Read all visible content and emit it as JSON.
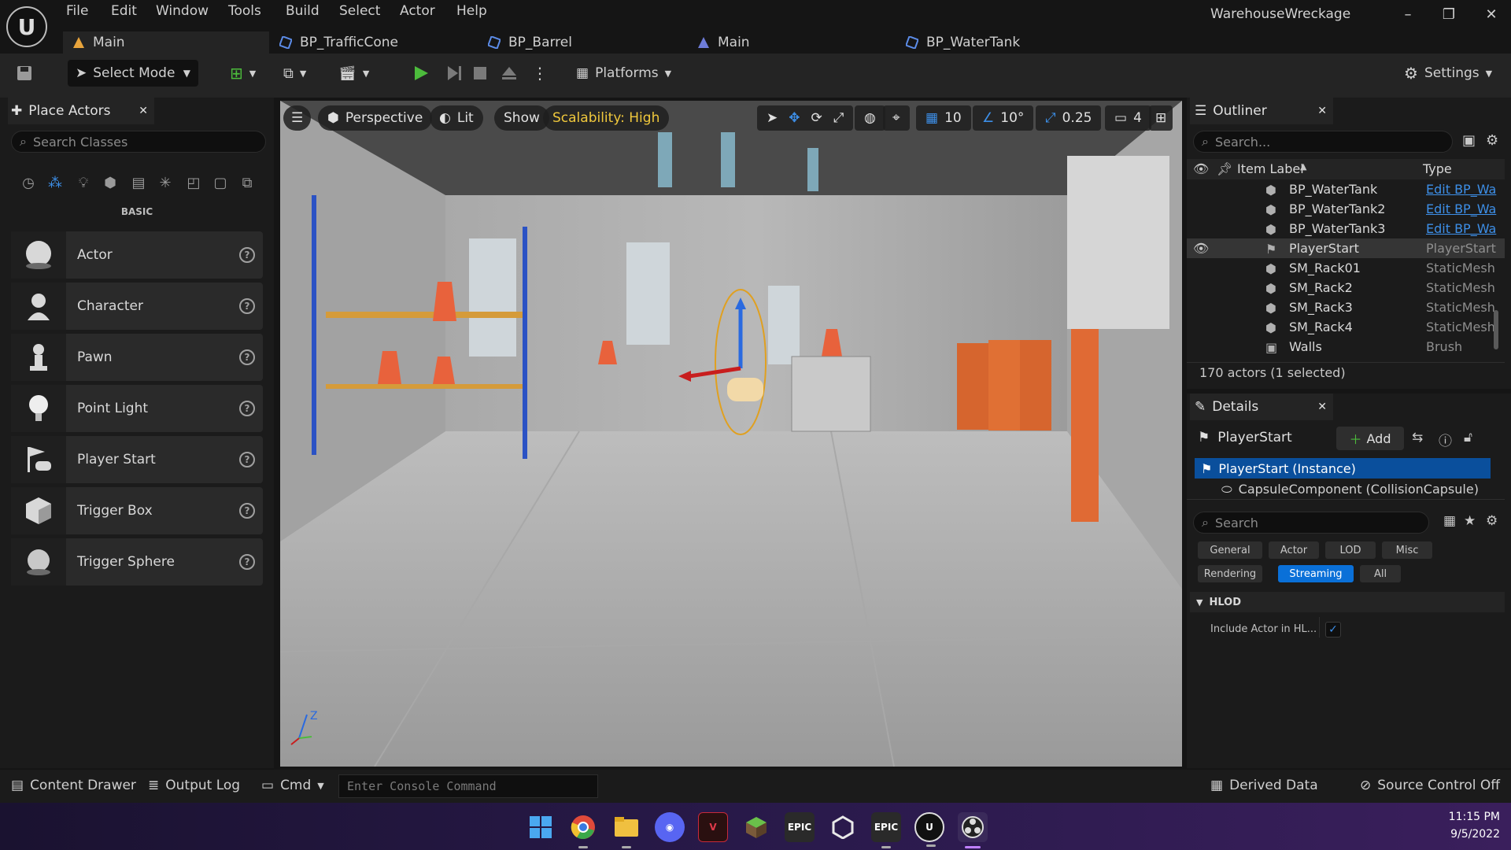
{
  "menu": [
    "File",
    "Edit",
    "Window",
    "Tools",
    "Build",
    "Select",
    "Actor",
    "Help"
  ],
  "project_name": "WarehouseWreckage",
  "tabs": [
    {
      "label": "Main",
      "icon": "level-icon"
    },
    {
      "label": "BP_TrafficCone",
      "icon": "blueprint-icon"
    },
    {
      "label": "BP_Barrel",
      "icon": "blueprint-icon"
    },
    {
      "label": "Main",
      "icon": "level-icon"
    },
    {
      "label": "BP_WaterTank",
      "icon": "blueprint-icon"
    }
  ],
  "toolbar": {
    "select_mode": "Select Mode",
    "platforms": "Platforms",
    "settings": "Settings"
  },
  "place_actors": {
    "title": "Place Actors",
    "search_placeholder": "Search Classes",
    "category": "BASIC",
    "items": [
      {
        "label": "Actor"
      },
      {
        "label": "Character"
      },
      {
        "label": "Pawn"
      },
      {
        "label": "Point Light"
      },
      {
        "label": "Player Start"
      },
      {
        "label": "Trigger Box"
      },
      {
        "label": "Trigger Sphere"
      }
    ]
  },
  "viewport": {
    "perspective": "Perspective",
    "lit": "Lit",
    "show": "Show",
    "scalability": "Scalability: High",
    "grid_snap": "10",
    "rotation_snap": "10°",
    "scale_snap": "0.25",
    "camera_speed": "4"
  },
  "outliner": {
    "title": "Outliner",
    "search_placeholder": "Search...",
    "col_label": "Item Label",
    "col_type": "Type",
    "rows": [
      {
        "name": "BP_WaterTank",
        "type": "Edit BP_Wa",
        "link": true,
        "selected": false
      },
      {
        "name": "BP_WaterTank2",
        "type": "Edit BP_Wa",
        "link": true,
        "selected": false
      },
      {
        "name": "BP_WaterTank3",
        "type": "Edit BP_Wa",
        "link": true,
        "selected": false
      },
      {
        "name": "PlayerStart",
        "type": "PlayerStart",
        "link": false,
        "selected": true
      },
      {
        "name": "SM_Rack01",
        "type": "StaticMesh",
        "link": false,
        "selected": false
      },
      {
        "name": "SM_Rack2",
        "type": "StaticMesh",
        "link": false,
        "selected": false
      },
      {
        "name": "SM_Rack3",
        "type": "StaticMesh",
        "link": false,
        "selected": false
      },
      {
        "name": "SM_Rack4",
        "type": "StaticMesh",
        "link": false,
        "selected": false
      },
      {
        "name": "Walls",
        "type": "Brush",
        "link": false,
        "selected": false
      }
    ],
    "count": "170 actors (1 selected)"
  },
  "details": {
    "title": "Details",
    "actor_name": "PlayerStart",
    "add_label": "Add",
    "instance": "PlayerStart (Instance)",
    "component": "CapsuleComponent (CollisionCapsule)",
    "search_placeholder": "Search",
    "filters_row1": [
      "General",
      "Actor",
      "LOD",
      "Misc"
    ],
    "filters_row2": [
      "Rendering",
      "Streaming",
      "All"
    ],
    "active_filter": "Streaming",
    "section": "HLOD",
    "property_label": "Include Actor in HL...",
    "property_checked": true
  },
  "statusbar": {
    "content_drawer": "Content Drawer",
    "output_log": "Output Log",
    "cmd": "Cmd",
    "console_placeholder": "Enter Console Command",
    "derived_data": "Derived Data",
    "source_control": "Source Control Off"
  },
  "taskbar": {
    "time": "11:15 PM",
    "date": "9/5/2022",
    "apps": [
      "windows-start-icon",
      "chrome-icon",
      "file-explorer-icon",
      "discord-icon",
      "app-v-icon",
      "minecraft-icon",
      "epic-games-icon",
      "unity-icon",
      "epic-games-icon",
      "unreal-engine-icon",
      "obs-icon"
    ]
  },
  "colors": {
    "accent_blue": "#0a70d8",
    "scalability_yellow": "#f0c83c",
    "play_green": "#4cbb3c"
  }
}
